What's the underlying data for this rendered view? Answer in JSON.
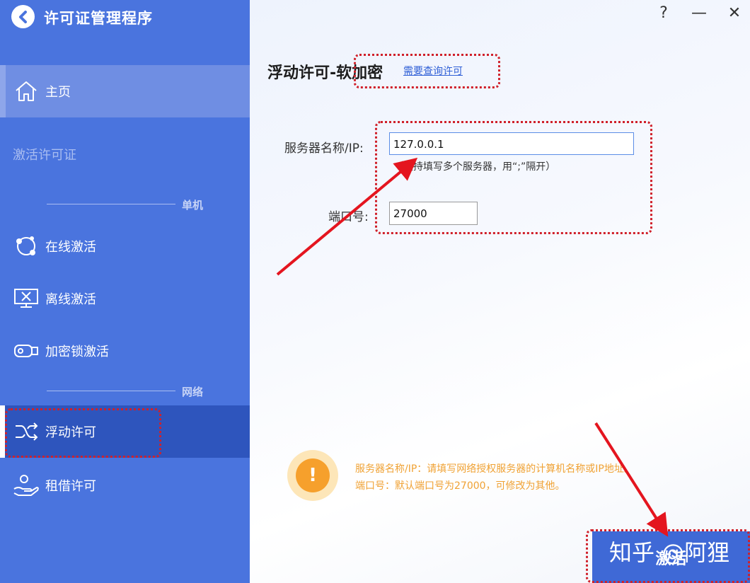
{
  "app": {
    "title": "许可证管理程序"
  },
  "sidebar": {
    "home": "主页",
    "section_activate": "激活许可证",
    "group_single": "单机",
    "online": "在线激活",
    "offline": "离线激活",
    "dongle": "加密锁激活",
    "group_network": "网络",
    "floating": "浮动许可",
    "lease": "租借许可"
  },
  "window": {
    "help": "?",
    "minimize": "—",
    "close": "✕"
  },
  "main": {
    "title": "浮动许可-软加密",
    "query_link": "需要查询许可",
    "server_label": "服务器名称/IP:",
    "server_value": "127.0.0.1",
    "server_hint": "（支持填写多个服务器，用“;”隔开）",
    "port_label": "端口号:",
    "port_value": "27000",
    "warning_icon": "!",
    "info_line1": "服务器名称/IP：请填写网络授权服务器的计算机名称或IP地址。",
    "info_line2": "端口号：默认端口号为27000，可修改为其他。",
    "activate_button": "激活"
  },
  "watermark": "知乎 @阿狸",
  "colors": {
    "sidebar": "#4a74de",
    "selected": "#2e55bd",
    "warning": "#f6a02c",
    "annotation": "#d0202a"
  }
}
